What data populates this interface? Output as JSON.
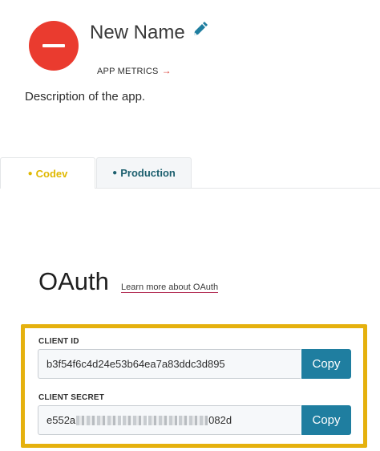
{
  "app": {
    "name": "New Name",
    "metrics_label": "APP METRICS",
    "metrics_arrow": "→",
    "description": "Description of the app.",
    "icon_color": "#ea3b2f"
  },
  "tabs": [
    {
      "label": "Codev",
      "dot": "●",
      "color": "#e0b800",
      "active": true
    },
    {
      "label": "Production",
      "dot": "●",
      "color": "#1c5f6e",
      "active": false
    }
  ],
  "oauth": {
    "title": "OAuth",
    "learn_more": "Learn more about OAuth",
    "client_id": {
      "label": "CLIENT ID",
      "value": "b3f54f6c4d24e53b64ea7a83ddc3d895",
      "copy_label": "Copy"
    },
    "client_secret": {
      "label": "CLIENT SECRET",
      "value_start": "e552a",
      "value_end": "082d",
      "copy_label": "Copy"
    },
    "highlight_color": "#e5b10e",
    "button_color": "#1f7ea0"
  }
}
